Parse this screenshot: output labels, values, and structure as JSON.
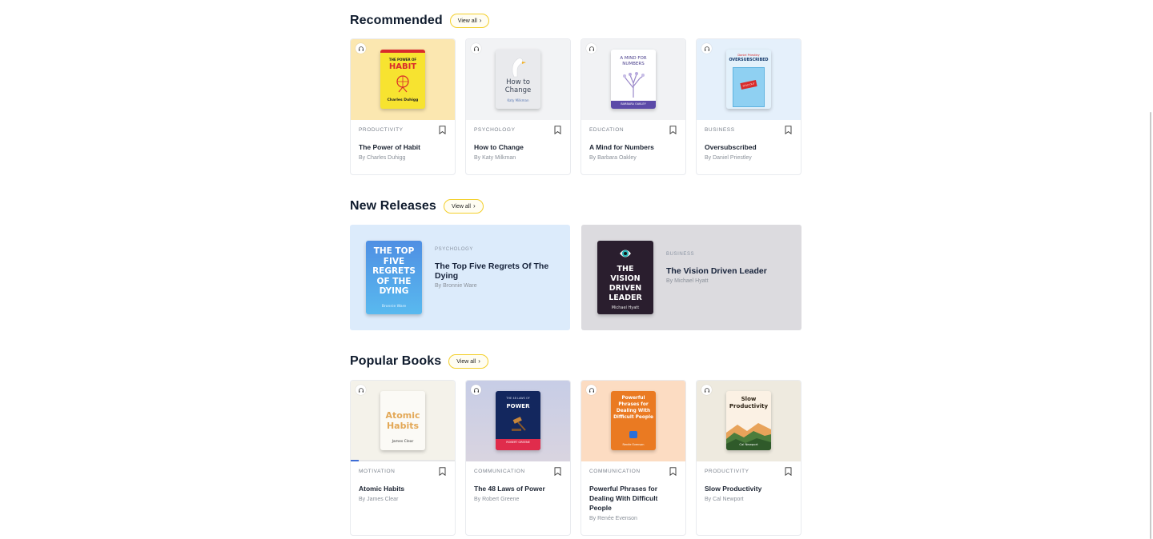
{
  "sections": {
    "recommended": {
      "title": "Recommended",
      "view_all": "View all",
      "cards": [
        {
          "category": "PRODUCTIVITY",
          "title": "The Power of Habit",
          "author": "By Charles Duhigg",
          "cover_top": "THE POWER OF",
          "cover_main": "HABIT",
          "cover_author": "Charles Duhigg",
          "audio_icon": "headphones-icon",
          "bookmark_icon": "bookmark-icon"
        },
        {
          "category": "PSYCHOLOGY",
          "title": "How to Change",
          "author": "By Katy Milkman",
          "cover_main": "How to Change",
          "cover_author": "Katy Milkman",
          "audio_icon": "headphones-icon",
          "bookmark_icon": "bookmark-icon"
        },
        {
          "category": "EDUCATION",
          "title": "A Mind for Numbers",
          "author": "By Barbara Oakley",
          "cover_main": "A MIND FOR NUMBERS",
          "cover_author": "BARBARA OAKLEY",
          "audio_icon": "headphones-icon",
          "bookmark_icon": "bookmark-icon"
        },
        {
          "category": "BUSINESS",
          "title": "Oversubscribed",
          "author": "By Daniel Priestley",
          "cover_top": "Daniel Priestley",
          "cover_main": "OVERSUBSCRIBED",
          "cover_sign": "SOLD OUT",
          "audio_icon": "headphones-icon",
          "bookmark_icon": "bookmark-icon"
        }
      ]
    },
    "new_releases": {
      "title": "New Releases",
      "view_all": "View all",
      "cards": [
        {
          "category": "PSYCHOLOGY",
          "title": "The Top Five Regrets Of The Dying",
          "author": "By Bronnie Ware",
          "cover_main": "THE TOP FIVE REGRETS OF THE DYING",
          "cover_author": "Bronnie Ware"
        },
        {
          "category": "BUSINESS",
          "title": "The Vision Driven Leader",
          "author": "By Michael Hyatt",
          "cover_main": "THE VISION DRIVEN LEADER",
          "cover_author": "Michael Hyatt"
        }
      ]
    },
    "popular": {
      "title": "Popular Books",
      "view_all": "View all",
      "cards": [
        {
          "category": "MOTIVATION",
          "title": "Atomic Habits",
          "author": "By James Clear",
          "cover_main": "Atomic Habits",
          "cover_author": "James Clear",
          "progress": 0.08,
          "audio_icon": "headphones-icon",
          "bookmark_icon": "bookmark-icon"
        },
        {
          "category": "COMMUNICATION",
          "title": "The 48 Laws of Power",
          "author": "By Robert Greene",
          "cover_top": "THE 48 LAWS OF",
          "cover_main": "POWER",
          "cover_author": "ROBERT GREENE",
          "audio_icon": "headphones-icon",
          "bookmark_icon": "bookmark-icon"
        },
        {
          "category": "COMMUNICATION",
          "title": "Powerful Phrases for Dealing With Difficult People",
          "author": "By Renée Evenson",
          "cover_main": "Powerful Phrases for Dealing With Difficult People",
          "cover_author": "Renée Evenson",
          "audio_icon": "headphones-icon",
          "bookmark_icon": "bookmark-icon"
        },
        {
          "category": "PRODUCTIVITY",
          "title": "Slow Productivity",
          "author": "By Cal Newport",
          "cover_main": "Slow Productivity",
          "cover_author": "Cal Newport",
          "audio_icon": "headphones-icon",
          "bookmark_icon": "bookmark-icon"
        }
      ]
    }
  },
  "colors": {
    "accent_yellow": "#f3cf2b",
    "progress_blue": "#3e6dd6",
    "title_dark": "#0f1b2d",
    "meta_grey": "#8a9099"
  }
}
